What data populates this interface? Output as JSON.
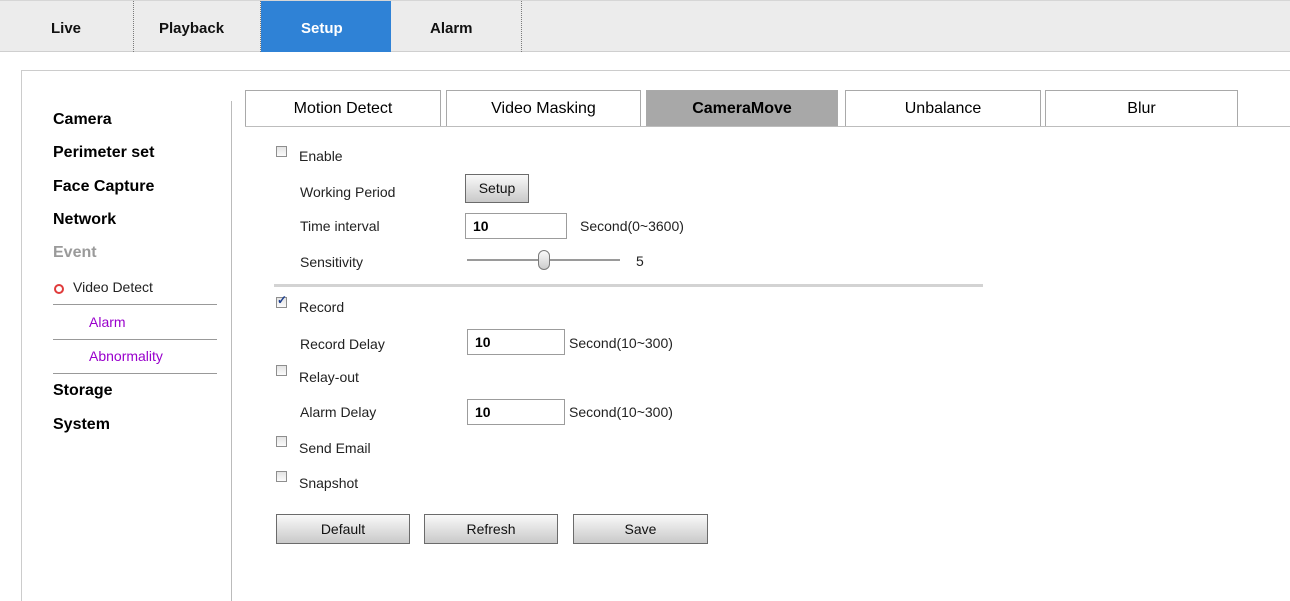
{
  "top_nav": {
    "live": "Live",
    "playback": "Playback",
    "setup": "Setup",
    "alarm": "Alarm"
  },
  "sidebar": {
    "camera": "Camera",
    "perimeter": "Perimeter set",
    "face_capture": "Face Capture",
    "network": "Network",
    "event": "Event",
    "event_items": {
      "video_detect": "Video Detect",
      "alarm": "Alarm",
      "abnormality": "Abnormality"
    },
    "storage": "Storage",
    "system": "System"
  },
  "tabs": {
    "motion_detect": "Motion Detect",
    "video_masking": "Video Masking",
    "camera_move": "CameraMove",
    "unbalance": "Unbalance",
    "blur": "Blur"
  },
  "form": {
    "enable": {
      "label": "Enable",
      "checked": false
    },
    "working_period": {
      "label": "Working Period",
      "button": "Setup"
    },
    "time_interval": {
      "label": "Time interval",
      "value": "10",
      "unit": "Second(0~3600)"
    },
    "sensitivity": {
      "label": "Sensitivity",
      "value": 5,
      "value_text": "5",
      "level_fraction": 0.5
    },
    "record": {
      "label": "Record",
      "checked": true
    },
    "record_delay": {
      "label": "Record Delay",
      "value": "10",
      "unit": "Second(10~300)"
    },
    "relay_out": {
      "label": "Relay-out",
      "checked": false
    },
    "alarm_delay": {
      "label": "Alarm Delay",
      "value": "10",
      "unit": "Second(10~300)"
    },
    "send_email": {
      "label": "Send Email",
      "checked": false
    },
    "snapshot": {
      "label": "Snapshot",
      "checked": false
    }
  },
  "buttons": {
    "default": "Default",
    "refresh": "Refresh",
    "save": "Save"
  },
  "colors": {
    "active_top_tab": "#2f82d6",
    "active_tab": "#a8a8a8",
    "submenu_link": "#9900cc",
    "bullet": "#e03b3b"
  }
}
